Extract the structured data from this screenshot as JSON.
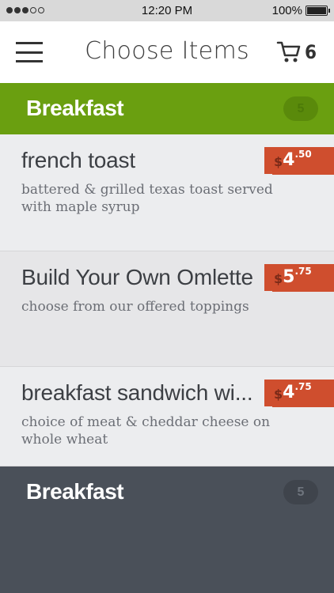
{
  "status": {
    "time": "12:20 PM",
    "battery": "100%"
  },
  "nav": {
    "title": "Choose Items",
    "cart_count": "6"
  },
  "categories": [
    {
      "title": "Breakfast",
      "count": "5"
    },
    {
      "title": "Breakfast",
      "count": "5"
    }
  ],
  "items": [
    {
      "name": "french toast",
      "description": "battered & grilled texas toast served with maple syrup",
      "currency": "$",
      "dollars": "4",
      "cents": ".50"
    },
    {
      "name": "Build Your Own Omlette",
      "description": "choose from our offered toppings",
      "currency": "$",
      "dollars": "5",
      "cents": ".75"
    },
    {
      "name": "breakfast sandwich wi...",
      "description": "choice of meat & cheddar cheese on whole wheat",
      "currency": "$",
      "dollars": "4",
      "cents": ".75"
    }
  ],
  "colors": {
    "accent_green": "#6a9f10",
    "price_red": "#cf4e2e",
    "dark_panel": "#4a5059"
  },
  "icons": {
    "menu": "hamburger-icon",
    "cart": "cart-icon"
  }
}
